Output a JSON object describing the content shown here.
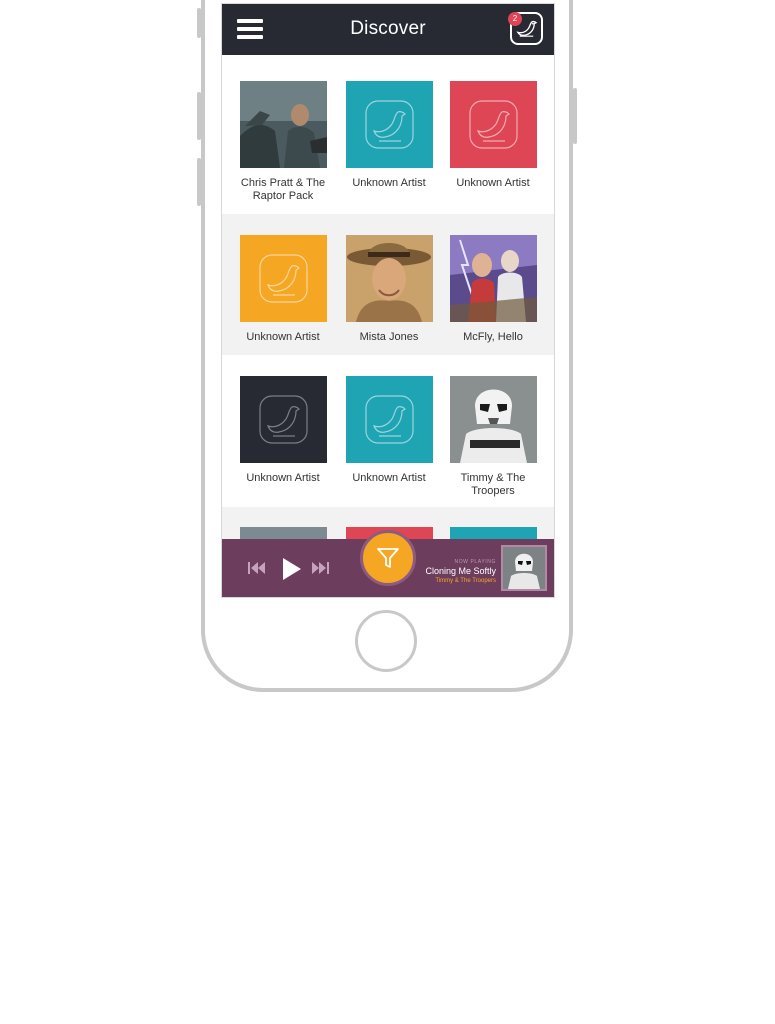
{
  "header": {
    "title": "Discover",
    "badge_count": "2"
  },
  "grid": {
    "rows": [
      {
        "tiles": [
          {
            "label": "Chris Pratt & The Raptor Pack",
            "art": "photo-raptor"
          },
          {
            "label": "Unknown Artist",
            "art": "placeholder",
            "color": "#1fa4b3"
          },
          {
            "label": "Unknown Artist",
            "art": "placeholder",
            "color": "#df4655"
          }
        ]
      },
      {
        "tiles": [
          {
            "label": "Unknown Artist",
            "art": "placeholder",
            "color": "#f5a623"
          },
          {
            "label": "Mista Jones",
            "art": "photo-adventurer"
          },
          {
            "label": "McFly, Hello",
            "art": "photo-time-travel"
          }
        ]
      },
      {
        "tiles": [
          {
            "label": "Unknown Artist",
            "art": "placeholder",
            "color": "#272a33"
          },
          {
            "label": "Unknown Artist",
            "art": "placeholder",
            "color": "#1fa4b3"
          },
          {
            "label": "Timmy & The Troopers",
            "art": "photo-trooper"
          }
        ]
      }
    ]
  },
  "player": {
    "now_playing_label": "NOW PLAYING",
    "song_title": "Cloning Me Softly",
    "artist": "Timmy & The Troopers"
  },
  "colors": {
    "topbar": "#272a33",
    "player": "#6d3d5e",
    "accent": "#f5a623",
    "teal": "#1fa4b3",
    "red": "#df4655"
  }
}
